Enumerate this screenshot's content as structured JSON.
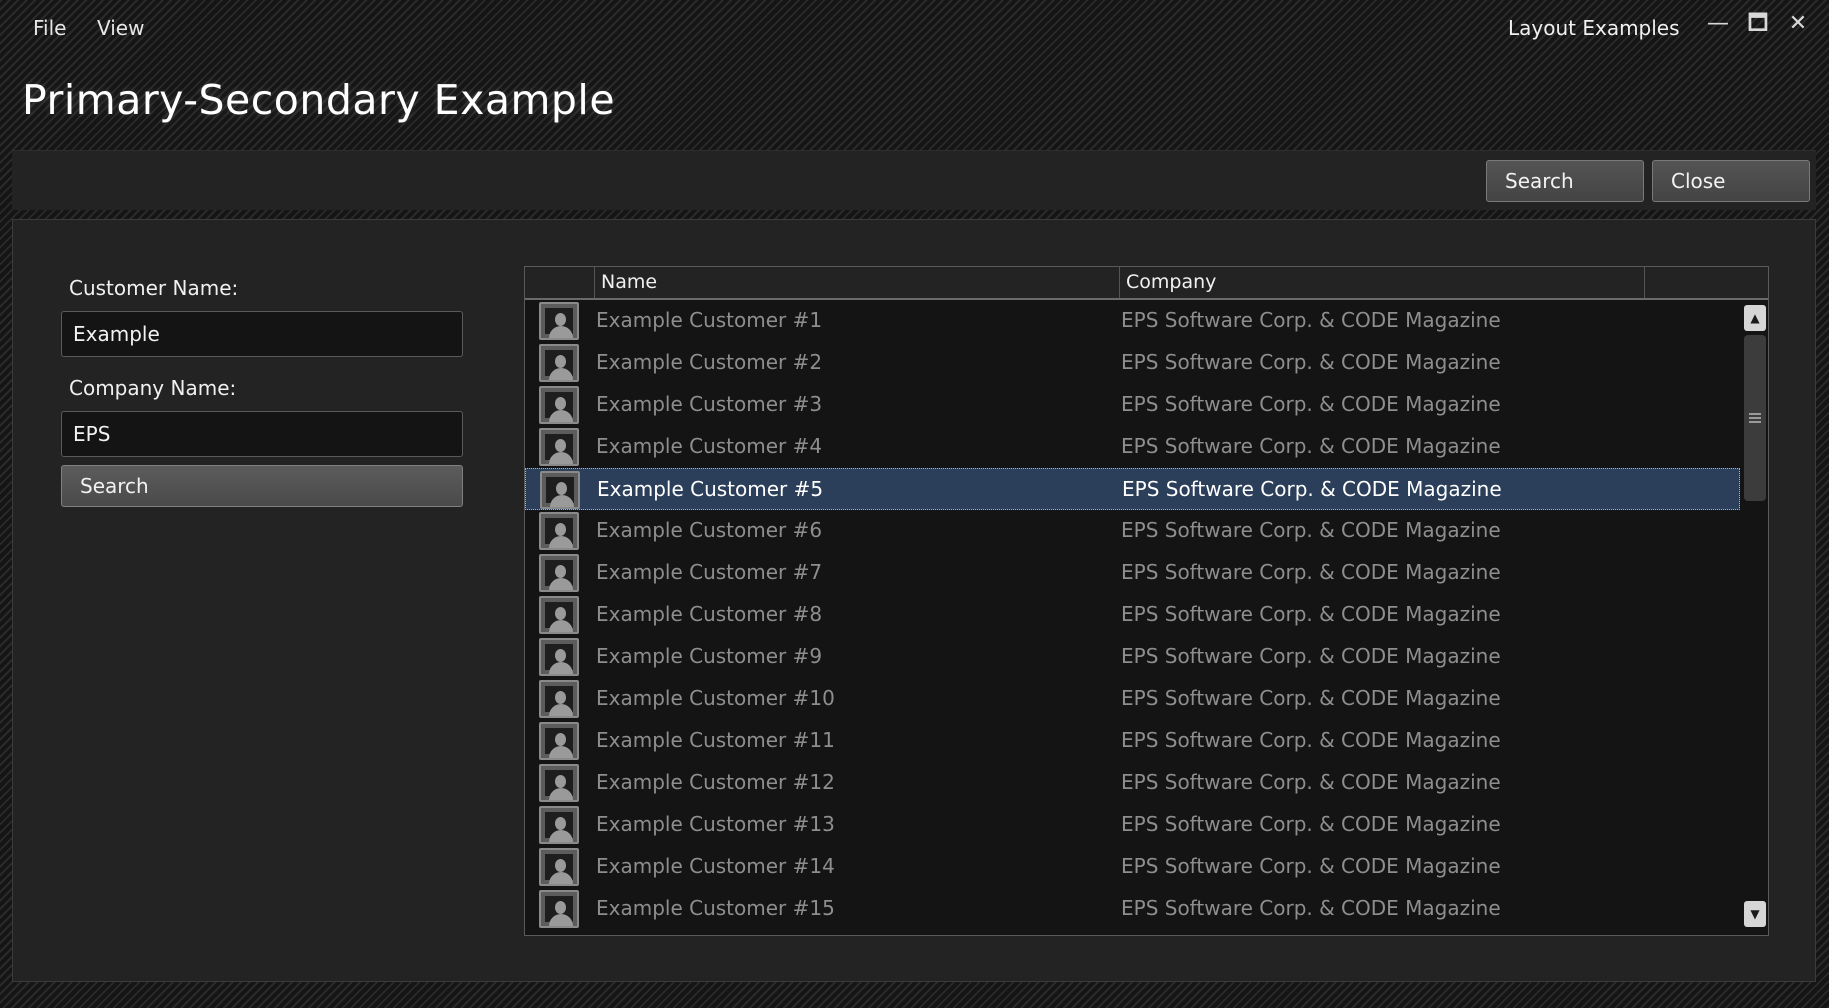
{
  "menu": {
    "file": "File",
    "view": "View"
  },
  "window": {
    "title": "Layout Examples",
    "minimize": "—",
    "maximize": "🗖",
    "close": "✕"
  },
  "page": {
    "title": "Primary-Secondary Example"
  },
  "toolbar": {
    "search_label": "Search",
    "close_label": "Close"
  },
  "form": {
    "customer_label": "Customer Name:",
    "customer_value": "Example",
    "company_label": "Company Name:",
    "company_value": "EPS",
    "search_label": "Search"
  },
  "grid": {
    "columns": [
      "",
      "Name",
      "Company",
      ""
    ],
    "selected_index": 4,
    "rows": [
      {
        "name": "Example Customer #1",
        "company": "EPS Software Corp. & CODE Magazine"
      },
      {
        "name": "Example Customer #2",
        "company": "EPS Software Corp. & CODE Magazine"
      },
      {
        "name": "Example Customer #3",
        "company": "EPS Software Corp. & CODE Magazine"
      },
      {
        "name": "Example Customer #4",
        "company": "EPS Software Corp. & CODE Magazine"
      },
      {
        "name": "Example Customer #5",
        "company": "EPS Software Corp. & CODE Magazine"
      },
      {
        "name": "Example Customer #6",
        "company": "EPS Software Corp. & CODE Magazine"
      },
      {
        "name": "Example Customer #7",
        "company": "EPS Software Corp. & CODE Magazine"
      },
      {
        "name": "Example Customer #8",
        "company": "EPS Software Corp. & CODE Magazine"
      },
      {
        "name": "Example Customer #9",
        "company": "EPS Software Corp. & CODE Magazine"
      },
      {
        "name": "Example Customer #10",
        "company": "EPS Software Corp. & CODE Magazine"
      },
      {
        "name": "Example Customer #11",
        "company": "EPS Software Corp. & CODE Magazine"
      },
      {
        "name": "Example Customer #12",
        "company": "EPS Software Corp. & CODE Magazine"
      },
      {
        "name": "Example Customer #13",
        "company": "EPS Software Corp. & CODE Magazine"
      },
      {
        "name": "Example Customer #14",
        "company": "EPS Software Corp. & CODE Magazine"
      },
      {
        "name": "Example Customer #15",
        "company": "EPS Software Corp. & CODE Magazine"
      }
    ]
  },
  "scrollbar": {
    "up": "▲",
    "down": "▼"
  },
  "icons": {
    "row_icon": "user-photo-icon"
  },
  "colors": {
    "selection": "#2b3e5a",
    "background": "#232323"
  }
}
